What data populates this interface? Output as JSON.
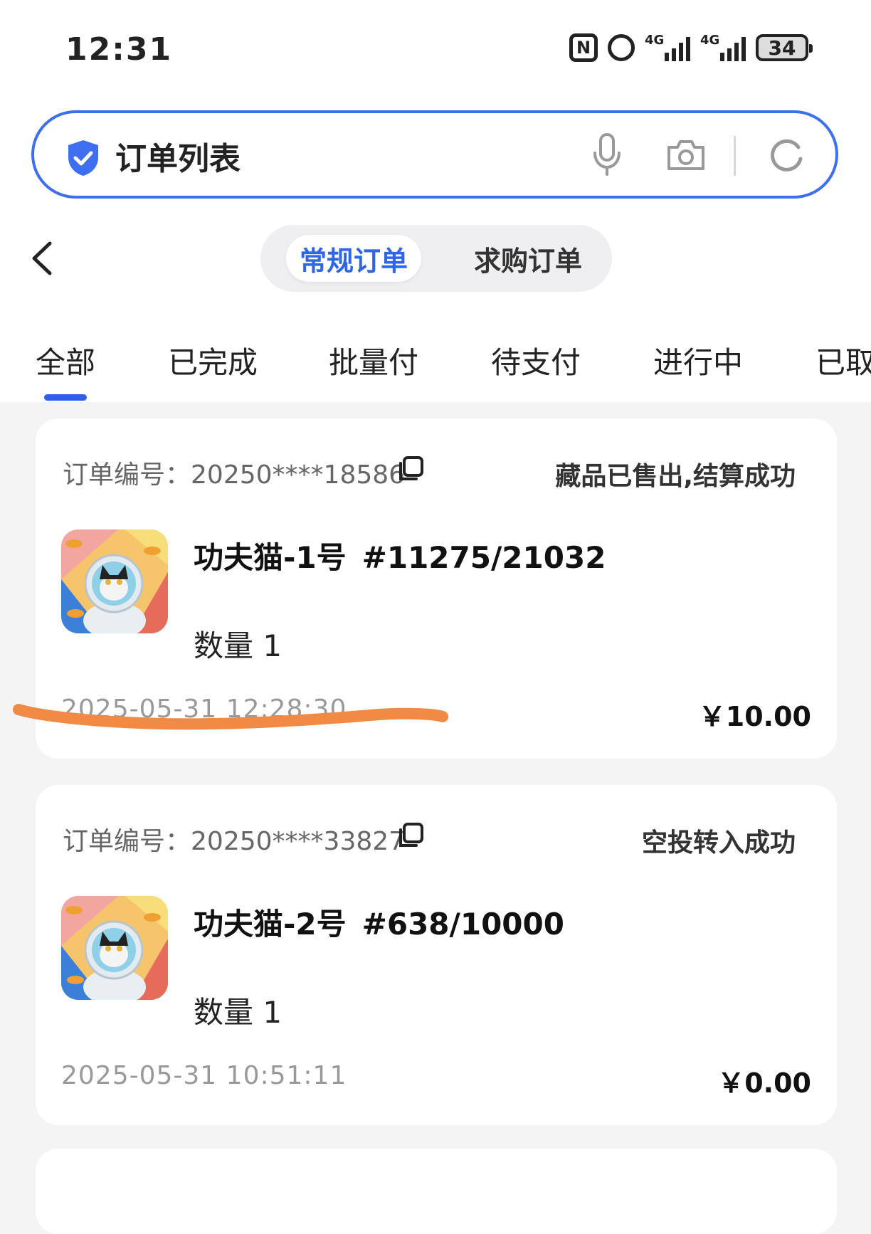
{
  "status_bar": {
    "time": "12:31",
    "signal1_label": "4G",
    "signal2_label": "4G",
    "battery": "34",
    "icons": [
      "nfc-icon",
      "alarm-icon",
      "signal-icon",
      "signal-icon",
      "battery-icon"
    ]
  },
  "search": {
    "title": "订单列表",
    "icons": [
      "shield-check-icon",
      "microphone-icon",
      "camera-icon",
      "reload-icon"
    ],
    "accent_color": "#3d6ff0"
  },
  "segment": {
    "active": "常规订单",
    "inactive": "求购订单",
    "active_color": "#2f66e8"
  },
  "tabs": [
    "全部",
    "已完成",
    "批量付",
    "待支付",
    "进行中",
    "已取"
  ],
  "selected_tab": "全部",
  "orders": [
    {
      "label": "订单编号：",
      "number": "20250****18586",
      "status": "藏品已售出,结算成功",
      "name": "功夫猫-1号",
      "serial": "#11275/21032",
      "quantity": "数量 1",
      "datetime": "2025-05-31 12:28:30",
      "price": "￥10.00"
    },
    {
      "label": "订单编号：",
      "number": "20250****33827",
      "status": "空投转入成功",
      "name": "功夫猫-2号",
      "serial": "#638/10000",
      "quantity": "数量 1",
      "datetime": "2025-05-31 10:51:11",
      "price": "￥0.00"
    }
  ],
  "annotation_color": "#f08a45"
}
